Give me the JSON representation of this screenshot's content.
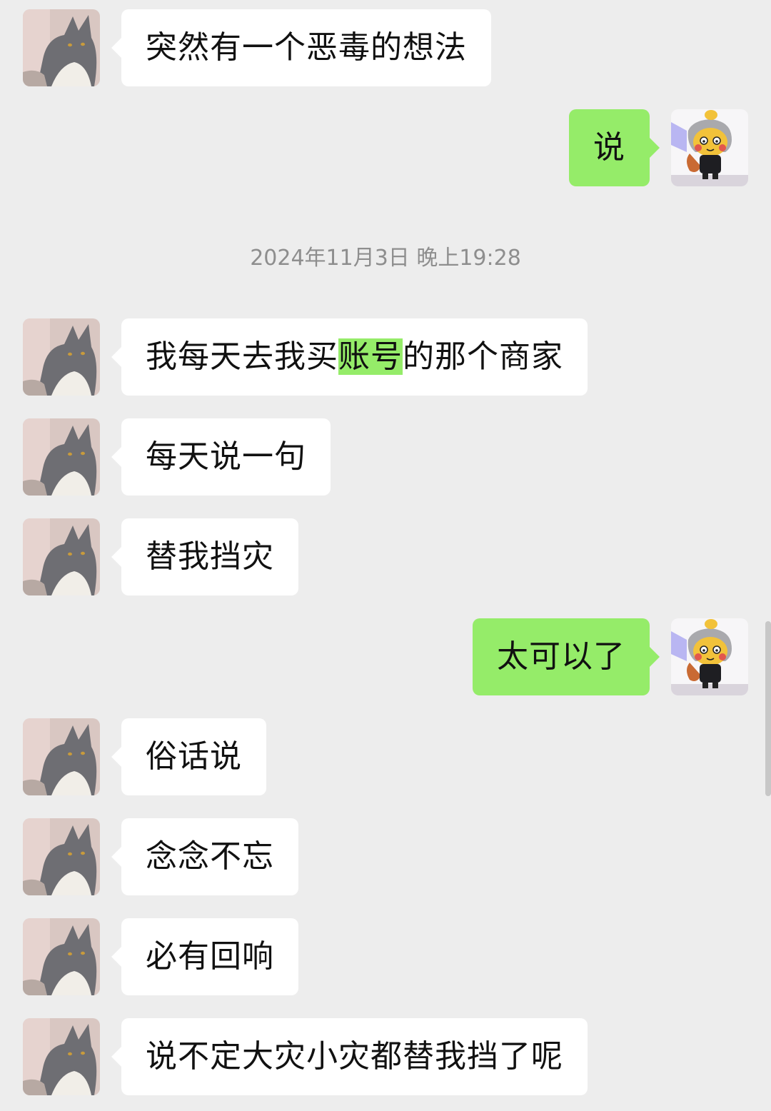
{
  "colors": {
    "background": "#EDEDED",
    "incoming_bubble": "#FFFFFF",
    "outgoing_bubble": "#95EC69",
    "timestamp_text": "#8E8E8E"
  },
  "icons": {
    "contact_avatar": "cat-avatar-icon",
    "self_avatar": "cartoon-avatar-icon"
  },
  "timestamp": "2024年11月3日 晚上19:28",
  "messages": {
    "m1": {
      "text": "突然有一个恶毒的想法"
    },
    "m2": {
      "text": "说"
    },
    "m3": {
      "before": "我每天去我买",
      "highlight": "账号",
      "after": "的那个商家"
    },
    "m4": {
      "text": "每天说一句"
    },
    "m5": {
      "text": "替我挡灾"
    },
    "m6": {
      "text": "太可以了"
    },
    "m7": {
      "text": "俗话说"
    },
    "m8": {
      "text": "念念不忘"
    },
    "m9": {
      "text": "必有回响"
    },
    "m10": {
      "text": "说不定大灾小灾都替我挡了呢"
    }
  }
}
